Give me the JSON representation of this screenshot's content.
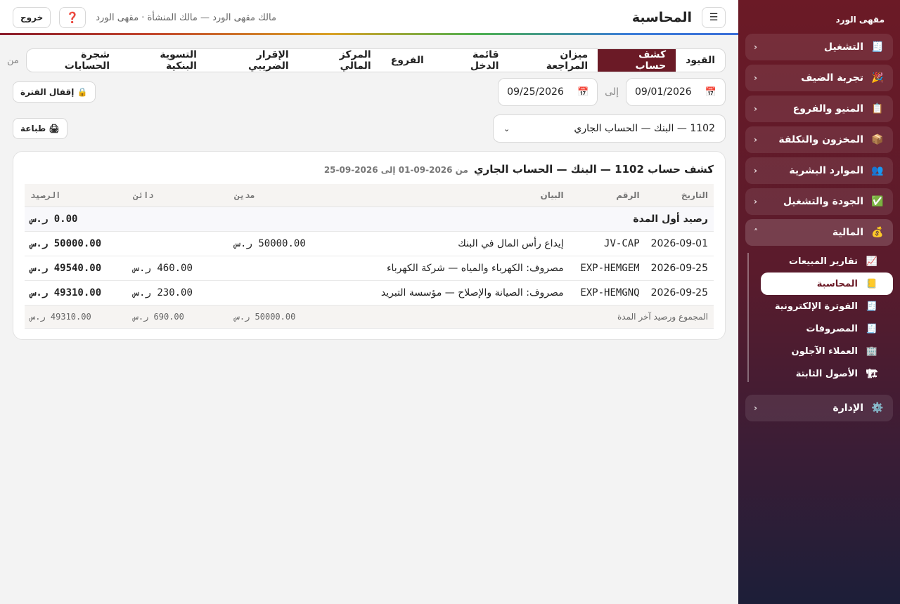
{
  "sidebar": {
    "brand": "مقهى الورد",
    "groups": [
      {
        "label": "التشغيل",
        "icon": "🧾"
      },
      {
        "label": "تجربة الضيف",
        "icon": "🎉"
      },
      {
        "label": "المنيو والفروع",
        "icon": "📋"
      },
      {
        "label": "المخزون والتكلفة",
        "icon": "📦"
      },
      {
        "label": "الموارد البشرية",
        "icon": "👥"
      },
      {
        "label": "الجودة والتشغيل",
        "icon": "✅"
      },
      {
        "label": "المالية",
        "icon": "💰"
      },
      {
        "label": "الإدارة",
        "icon": "⚙️"
      }
    ],
    "finance_items": [
      {
        "label": "تقارير المبيعات",
        "icon": "📈"
      },
      {
        "label": "المحاسبة",
        "icon": "📒"
      },
      {
        "label": "الفوترة الإلكترونية",
        "icon": "🧾"
      },
      {
        "label": "المصروفات",
        "icon": "🧾"
      },
      {
        "label": "العملاء الآجلون",
        "icon": "🏢"
      },
      {
        "label": "الأصول الثابتة",
        "icon": "🏗"
      }
    ],
    "chevron_closed": "‹",
    "chevron_open": "˄"
  },
  "header": {
    "menu_icon": "☰",
    "title": "المحاسبة",
    "user": "مالك مقهى الورد — مالك المنشأة · مقهى الورد",
    "help_icon": "❓",
    "logout": "خروج"
  },
  "tabs": [
    "القيود",
    "كشف حساب",
    "ميزان المراجعة",
    "قائمة الدخل",
    "الفروع",
    "المركز المالي",
    "الإقرار الضريبي",
    "التسوية البنكية",
    "شجرة الحسابات"
  ],
  "tabs_more": "من",
  "filters": {
    "from_date": "09/01/2026",
    "to_label": "إلى",
    "to_date": "09/25/2026",
    "calendar_icon": "📅",
    "lock_label": "🔒 إقفال الفترة",
    "account": "1102 — البنك — الحساب الجاري",
    "print_label": "🖨 طباعة"
  },
  "statement": {
    "title": "كشف حساب 1102 — البنك — الحساب الجاري",
    "range": "من 2026-09-01 إلى 2026-09-25",
    "columns": [
      "التاريخ",
      "الرقم",
      "البيان",
      "مدين",
      "دائن",
      "الرصيد"
    ],
    "opening_label": "رصيد أول المدة",
    "opening_balance": "0.00 ر.س",
    "rows": [
      {
        "date": "2026-09-01",
        "ref": "JV-CAP",
        "desc": "إيداع رأس المال في البنك",
        "debit": "50000.00 ر.س",
        "credit": "",
        "balance": "50000.00 ر.س"
      },
      {
        "date": "2026-09-25",
        "ref": "EXP-HEMGEM",
        "desc": "مصروف: الكهرباء والمياه — شركة الكهرباء",
        "debit": "",
        "credit": "460.00 ر.س",
        "balance": "49540.00 ر.س"
      },
      {
        "date": "2026-09-25",
        "ref": "EXP-HEMGNQ",
        "desc": "مصروف: الصيانة والإصلاح — مؤسسة التبريد",
        "debit": "",
        "credit": "230.00 ر.س",
        "balance": "49310.00 ر.س"
      }
    ],
    "total_label": "المجموع ورصيد آخر المدة",
    "total_debit": "50000.00 ر.س",
    "total_credit": "690.00 ر.س",
    "total_balance": "49310.00 ر.س"
  }
}
